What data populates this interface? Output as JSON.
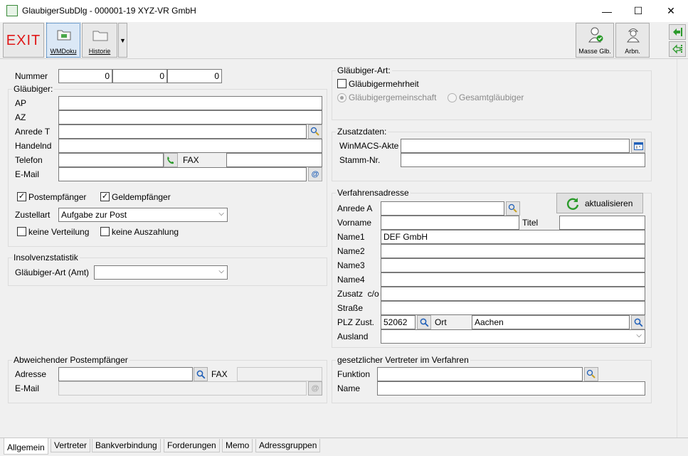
{
  "window": {
    "title": "GlaubigerSubDlg - 000001-19 XYZ-VR GmbH",
    "minimize": "—",
    "maximize": "☐",
    "close": "✕"
  },
  "toolbar": {
    "exit_label": "EXIT",
    "wmdoku_label": "WMDoku",
    "historie_label": "Historie",
    "masse_label": "Masse Glb.",
    "arbn_label": "Arbn."
  },
  "main": {
    "nummer_label": "Nummer",
    "nummer_values": [
      "0",
      "0",
      "0"
    ],
    "glaeubiger_group": "Gläubiger:",
    "ap_label": "AP",
    "az_label": "AZ",
    "anrede_t_label": "Anrede T",
    "handelnd_label": "Handelnd",
    "telefon_label": "Telefon",
    "fax_label": "FAX",
    "email_label": "E-Mail",
    "postempfaenger_label": "Postempfänger",
    "geldempfaenger_label": "Geldempfänger",
    "zustellart_label": "Zustellart",
    "zustellart_value": "Aufgabe zur Post",
    "keine_verteilung_label": "keine Verteilung",
    "keine_auszahlung_label": "keine Auszahlung"
  },
  "insolvenz": {
    "title": "Insolvenzstatistik",
    "glaeubiger_art_amt_label": "Gläubiger-Art (Amt)",
    "glaeubiger_art_amt_value": ""
  },
  "abweichend": {
    "title": "Abweichender Postempfänger",
    "adresse_label": "Adresse",
    "fax_label": "FAX",
    "email_label": "E-Mail"
  },
  "glaeubiger_art": {
    "title": "Gläubiger-Art:",
    "mehrheit_label": "Gläubigermehrheit",
    "gemeinschaft_label": "Gläubigergemeinschaft",
    "gesamt_label": "Gesamtgläubiger"
  },
  "zusatz": {
    "title": "Zusatzdaten:",
    "winmacs_label": "WinMACS-Akte",
    "stamm_label": "Stamm-Nr."
  },
  "verfahren": {
    "title": "Verfahrensadresse",
    "aktualisieren_label": "aktualisieren",
    "anrede_a_label": "Anrede A",
    "vorname_label": "Vorname",
    "titel_label": "Titel",
    "name1_label": "Name1",
    "name1_value": "DEF GmbH",
    "name2_label": "Name2",
    "name3_label": "Name3",
    "name4_label": "Name4",
    "zusatz_label": "Zusatz  c/o",
    "strasse_label": "Straße",
    "plz_label": "PLZ Zust.",
    "plz_value": "52062",
    "ort_label": "Ort",
    "ort_value": "Aachen",
    "ausland_label": "Ausland"
  },
  "vertreter": {
    "title": "gesetzlicher Vertreter im Verfahren",
    "funktion_label": "Funktion",
    "name_label": "Name"
  },
  "tabs": [
    "Allgemein",
    "Vertreter",
    "Bankverbindung",
    "Forderungen",
    "Memo",
    "Adressgruppen"
  ],
  "colors": {
    "exit": "#e01818",
    "accent_green": "#2a9a2a",
    "search_blue": "#1f5fb8"
  }
}
